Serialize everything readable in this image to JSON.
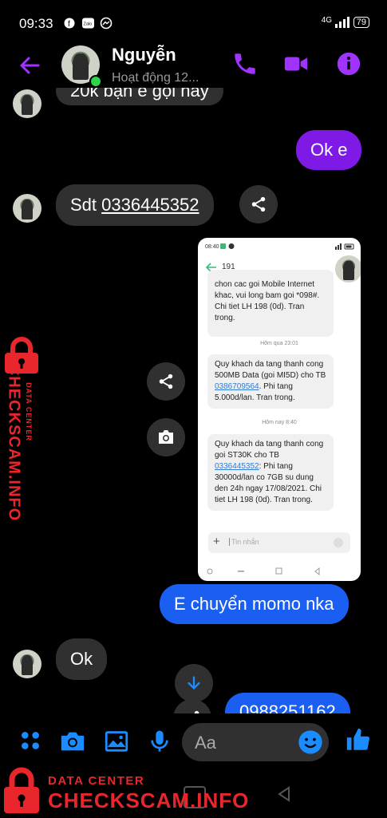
{
  "status": {
    "time": "09:33",
    "network": "4G",
    "battery": "79"
  },
  "header": {
    "name": "Nguyễn",
    "presence": "Hoạt động 12..."
  },
  "messages": {
    "partial_top": "20k bạn e gọi này",
    "ok_e": "Ok e",
    "sdt_prefix": "Sdt ",
    "sdt_number": "0336445352",
    "momo": "E chuyển momo nka",
    "ok": "Ok",
    "partial_bottom": "0988251162"
  },
  "screenshot": {
    "time": "08:40",
    "contact": "191",
    "sms1": "chon cac goi Mobile Internet khac, vui long bam goi *098#. Chi tiet LH 198 (0d). Tran trong.",
    "date1": "Hôm qua 23:01",
    "sms2_a": "Quy khach da tang thanh cong 500MB Data (goi MI5D) cho TB ",
    "sms2_link": "0386709564",
    "sms2_b": ". Phi tang 5.000d/lan. Tran trong.",
    "date2": "Hôm nay 8:40",
    "sms3_a": "Quy khach da tang thanh cong goi ST30K cho TB ",
    "sms3_link": "0336445352",
    "sms3_b": ": Phi tang 30000d/lan co 7GB su dung den 24h ngay 17/08/2021. Chi tiet LH 198 (0d). Tran trong.",
    "input_placeholder": "Tin nhắn"
  },
  "composer": {
    "placeholder": "Aa"
  },
  "watermark": {
    "side_title": "CHECKSCAM.INFO",
    "side_sub": "DATA CENTER",
    "bottom_sub": "DATA CENTER",
    "bottom_title": "CHECKSCAM.INFO"
  },
  "colors": {
    "accent": "#a033ff",
    "outgoing": "#7f1ae6",
    "blue": "#1b5ff2",
    "incoming": "#303030",
    "watermark": "#e8262b"
  }
}
